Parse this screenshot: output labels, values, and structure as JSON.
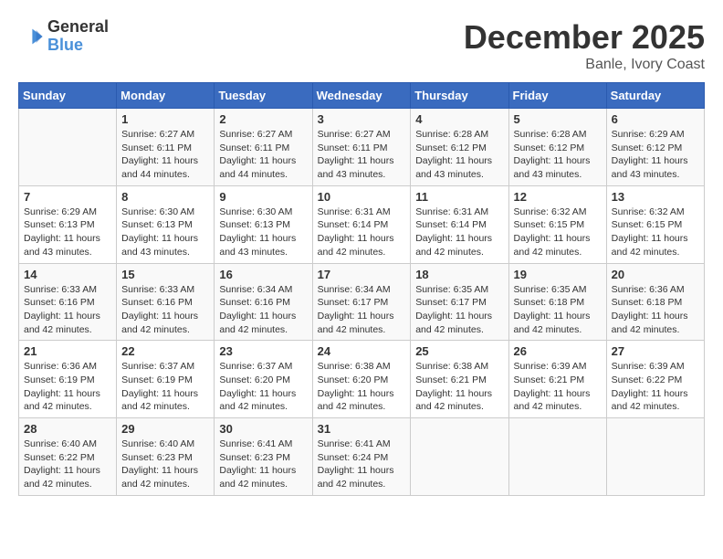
{
  "logo": {
    "general": "General",
    "blue": "Blue"
  },
  "title": "December 2025",
  "location": "Banle, Ivory Coast",
  "days_header": [
    "Sunday",
    "Monday",
    "Tuesday",
    "Wednesday",
    "Thursday",
    "Friday",
    "Saturday"
  ],
  "weeks": [
    [
      {
        "day": "",
        "info": ""
      },
      {
        "day": "1",
        "info": "Sunrise: 6:27 AM\nSunset: 6:11 PM\nDaylight: 11 hours\nand 44 minutes."
      },
      {
        "day": "2",
        "info": "Sunrise: 6:27 AM\nSunset: 6:11 PM\nDaylight: 11 hours\nand 44 minutes."
      },
      {
        "day": "3",
        "info": "Sunrise: 6:27 AM\nSunset: 6:11 PM\nDaylight: 11 hours\nand 43 minutes."
      },
      {
        "day": "4",
        "info": "Sunrise: 6:28 AM\nSunset: 6:12 PM\nDaylight: 11 hours\nand 43 minutes."
      },
      {
        "day": "5",
        "info": "Sunrise: 6:28 AM\nSunset: 6:12 PM\nDaylight: 11 hours\nand 43 minutes."
      },
      {
        "day": "6",
        "info": "Sunrise: 6:29 AM\nSunset: 6:12 PM\nDaylight: 11 hours\nand 43 minutes."
      }
    ],
    [
      {
        "day": "7",
        "info": "Sunrise: 6:29 AM\nSunset: 6:13 PM\nDaylight: 11 hours\nand 43 minutes."
      },
      {
        "day": "8",
        "info": "Sunrise: 6:30 AM\nSunset: 6:13 PM\nDaylight: 11 hours\nand 43 minutes."
      },
      {
        "day": "9",
        "info": "Sunrise: 6:30 AM\nSunset: 6:13 PM\nDaylight: 11 hours\nand 43 minutes."
      },
      {
        "day": "10",
        "info": "Sunrise: 6:31 AM\nSunset: 6:14 PM\nDaylight: 11 hours\nand 42 minutes."
      },
      {
        "day": "11",
        "info": "Sunrise: 6:31 AM\nSunset: 6:14 PM\nDaylight: 11 hours\nand 42 minutes."
      },
      {
        "day": "12",
        "info": "Sunrise: 6:32 AM\nSunset: 6:15 PM\nDaylight: 11 hours\nand 42 minutes."
      },
      {
        "day": "13",
        "info": "Sunrise: 6:32 AM\nSunset: 6:15 PM\nDaylight: 11 hours\nand 42 minutes."
      }
    ],
    [
      {
        "day": "14",
        "info": "Sunrise: 6:33 AM\nSunset: 6:16 PM\nDaylight: 11 hours\nand 42 minutes."
      },
      {
        "day": "15",
        "info": "Sunrise: 6:33 AM\nSunset: 6:16 PM\nDaylight: 11 hours\nand 42 minutes."
      },
      {
        "day": "16",
        "info": "Sunrise: 6:34 AM\nSunset: 6:16 PM\nDaylight: 11 hours\nand 42 minutes."
      },
      {
        "day": "17",
        "info": "Sunrise: 6:34 AM\nSunset: 6:17 PM\nDaylight: 11 hours\nand 42 minutes."
      },
      {
        "day": "18",
        "info": "Sunrise: 6:35 AM\nSunset: 6:17 PM\nDaylight: 11 hours\nand 42 minutes."
      },
      {
        "day": "19",
        "info": "Sunrise: 6:35 AM\nSunset: 6:18 PM\nDaylight: 11 hours\nand 42 minutes."
      },
      {
        "day": "20",
        "info": "Sunrise: 6:36 AM\nSunset: 6:18 PM\nDaylight: 11 hours\nand 42 minutes."
      }
    ],
    [
      {
        "day": "21",
        "info": "Sunrise: 6:36 AM\nSunset: 6:19 PM\nDaylight: 11 hours\nand 42 minutes."
      },
      {
        "day": "22",
        "info": "Sunrise: 6:37 AM\nSunset: 6:19 PM\nDaylight: 11 hours\nand 42 minutes."
      },
      {
        "day": "23",
        "info": "Sunrise: 6:37 AM\nSunset: 6:20 PM\nDaylight: 11 hours\nand 42 minutes."
      },
      {
        "day": "24",
        "info": "Sunrise: 6:38 AM\nSunset: 6:20 PM\nDaylight: 11 hours\nand 42 minutes."
      },
      {
        "day": "25",
        "info": "Sunrise: 6:38 AM\nSunset: 6:21 PM\nDaylight: 11 hours\nand 42 minutes."
      },
      {
        "day": "26",
        "info": "Sunrise: 6:39 AM\nSunset: 6:21 PM\nDaylight: 11 hours\nand 42 minutes."
      },
      {
        "day": "27",
        "info": "Sunrise: 6:39 AM\nSunset: 6:22 PM\nDaylight: 11 hours\nand 42 minutes."
      }
    ],
    [
      {
        "day": "28",
        "info": "Sunrise: 6:40 AM\nSunset: 6:22 PM\nDaylight: 11 hours\nand 42 minutes."
      },
      {
        "day": "29",
        "info": "Sunrise: 6:40 AM\nSunset: 6:23 PM\nDaylight: 11 hours\nand 42 minutes."
      },
      {
        "day": "30",
        "info": "Sunrise: 6:41 AM\nSunset: 6:23 PM\nDaylight: 11 hours\nand 42 minutes."
      },
      {
        "day": "31",
        "info": "Sunrise: 6:41 AM\nSunset: 6:24 PM\nDaylight: 11 hours\nand 42 minutes."
      },
      {
        "day": "",
        "info": ""
      },
      {
        "day": "",
        "info": ""
      },
      {
        "day": "",
        "info": ""
      }
    ]
  ]
}
